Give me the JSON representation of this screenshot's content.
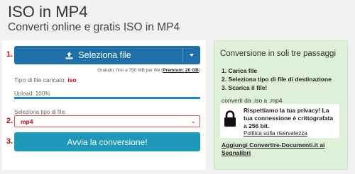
{
  "header": {
    "title": "ISO in MP4",
    "subtitle": "Converti online e gratis ISO in MP4"
  },
  "steps": {
    "one": "1.",
    "two": "2.",
    "three": "3."
  },
  "upload": {
    "button_label": "Seleziona file",
    "free_note_prefix": "Gratuito: fino a 750 MB per file (",
    "premium_link": "Premium: 20 GB",
    "free_note_suffix": ")",
    "file_type_label": "Tipo di file caricato:",
    "file_type_value": "iso",
    "progress_label": "Upload: 100%",
    "progress_value": 1.0
  },
  "format": {
    "label": "Seleziona tipo di file:",
    "selected": "mp4"
  },
  "convert_button": "Avvia la conversione!",
  "sidebar": {
    "title": "Conversione in soli tre passaggi",
    "steps": [
      "1. Carica file",
      "2. Seleziona tipo di file di destinazione",
      "3. Scarica il file!"
    ],
    "convert_from": "converti da .iso a .mp4",
    "privacy_text": "Rispettiamo la tua privacy! La tua connessione è crittografata a 256 bit.",
    "privacy_link": "Politica sulla riservatezza",
    "bookmark_link": "Aggiungi Convertire-Documenti.it ai Segnalibri"
  },
  "icons": {
    "upload": "upload-icon",
    "caret": "chevron-down-icon",
    "lock": "lock-icon"
  },
  "colors": {
    "primary_button": "#1e6faa",
    "convert_button": "#1d98b8",
    "accent_red": "#d9000d",
    "sidebar_bg": "#dff0d8"
  }
}
